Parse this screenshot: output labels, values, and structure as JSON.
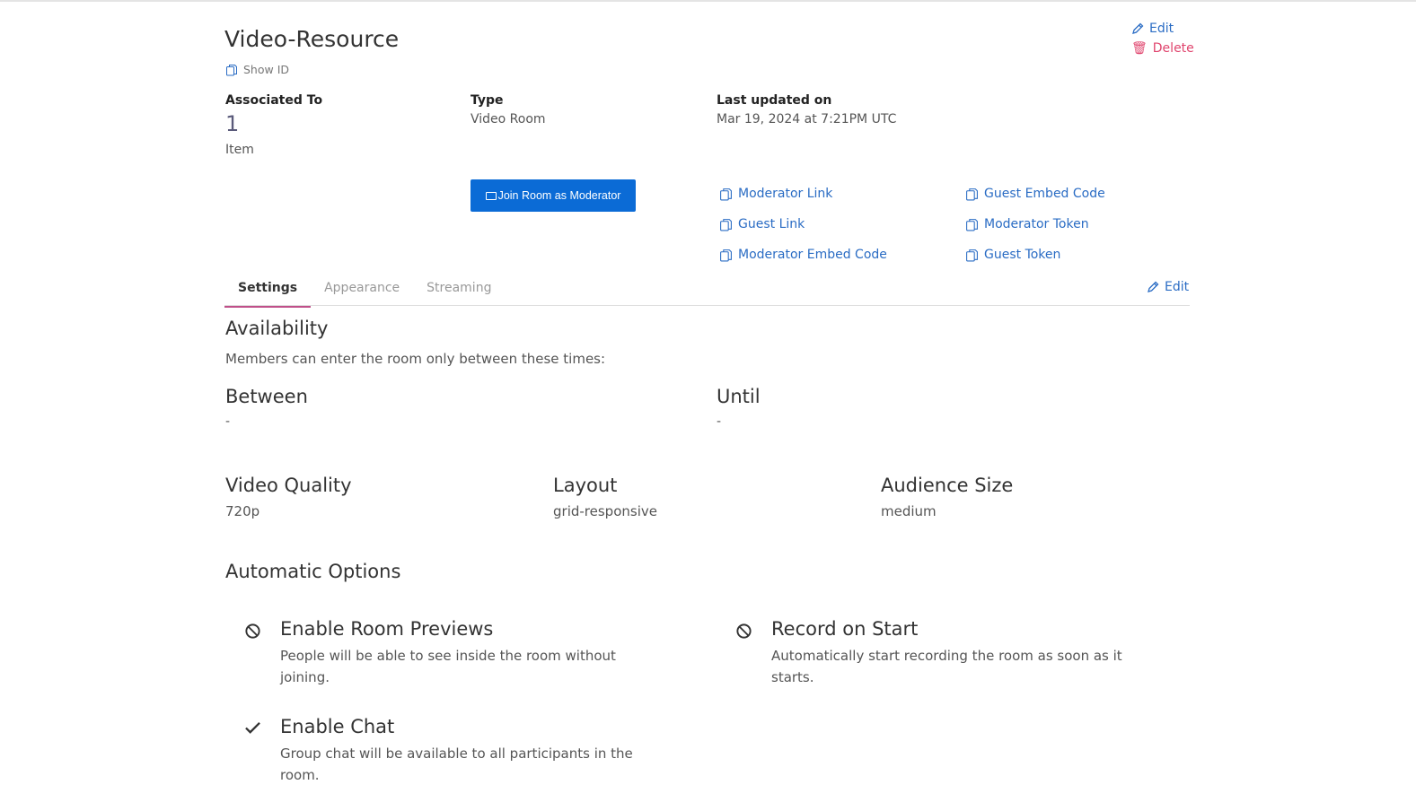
{
  "header": {
    "title": "Video-Resource",
    "show_id": "Show ID",
    "edit": "Edit",
    "delete": "Delete"
  },
  "meta": {
    "associated_label": "Associated To",
    "associated_count": "1",
    "associated_unit": "Item",
    "type_label": "Type",
    "type_value": "Video Room",
    "updated_label": "Last updated on",
    "updated_value": "Mar 19, 2024 at 7:21PM UTC"
  },
  "join_button": "Join Room as Moderator",
  "links": [
    "Moderator Link",
    "Guest Link",
    "Moderator Embed Code",
    "Guest Embed Code",
    "Moderator Token",
    "Guest Token"
  ],
  "tabs": [
    "Settings",
    "Appearance",
    "Streaming"
  ],
  "tab_edit": "Edit",
  "availability": {
    "title": "Availability",
    "desc": "Members can enter the room only between these times:",
    "between_label": "Between",
    "between_value": "-",
    "until_label": "Until",
    "until_value": "-"
  },
  "settings": {
    "video_quality_label": "Video Quality",
    "video_quality": "720p",
    "layout_label": "Layout",
    "layout": "grid-responsive",
    "audience_label": "Audience Size",
    "audience": "medium"
  },
  "automatic": {
    "title": "Automatic Options",
    "options": [
      {
        "title": "Enable Room Previews",
        "desc": "People will be able to see inside the room without joining.",
        "enabled": false
      },
      {
        "title": "Record on Start",
        "desc": "Automatically start recording the room as soon as it starts.",
        "enabled": false
      },
      {
        "title": "Enable Chat",
        "desc": "Group chat will be available to all participants in the room.",
        "enabled": true
      }
    ]
  }
}
